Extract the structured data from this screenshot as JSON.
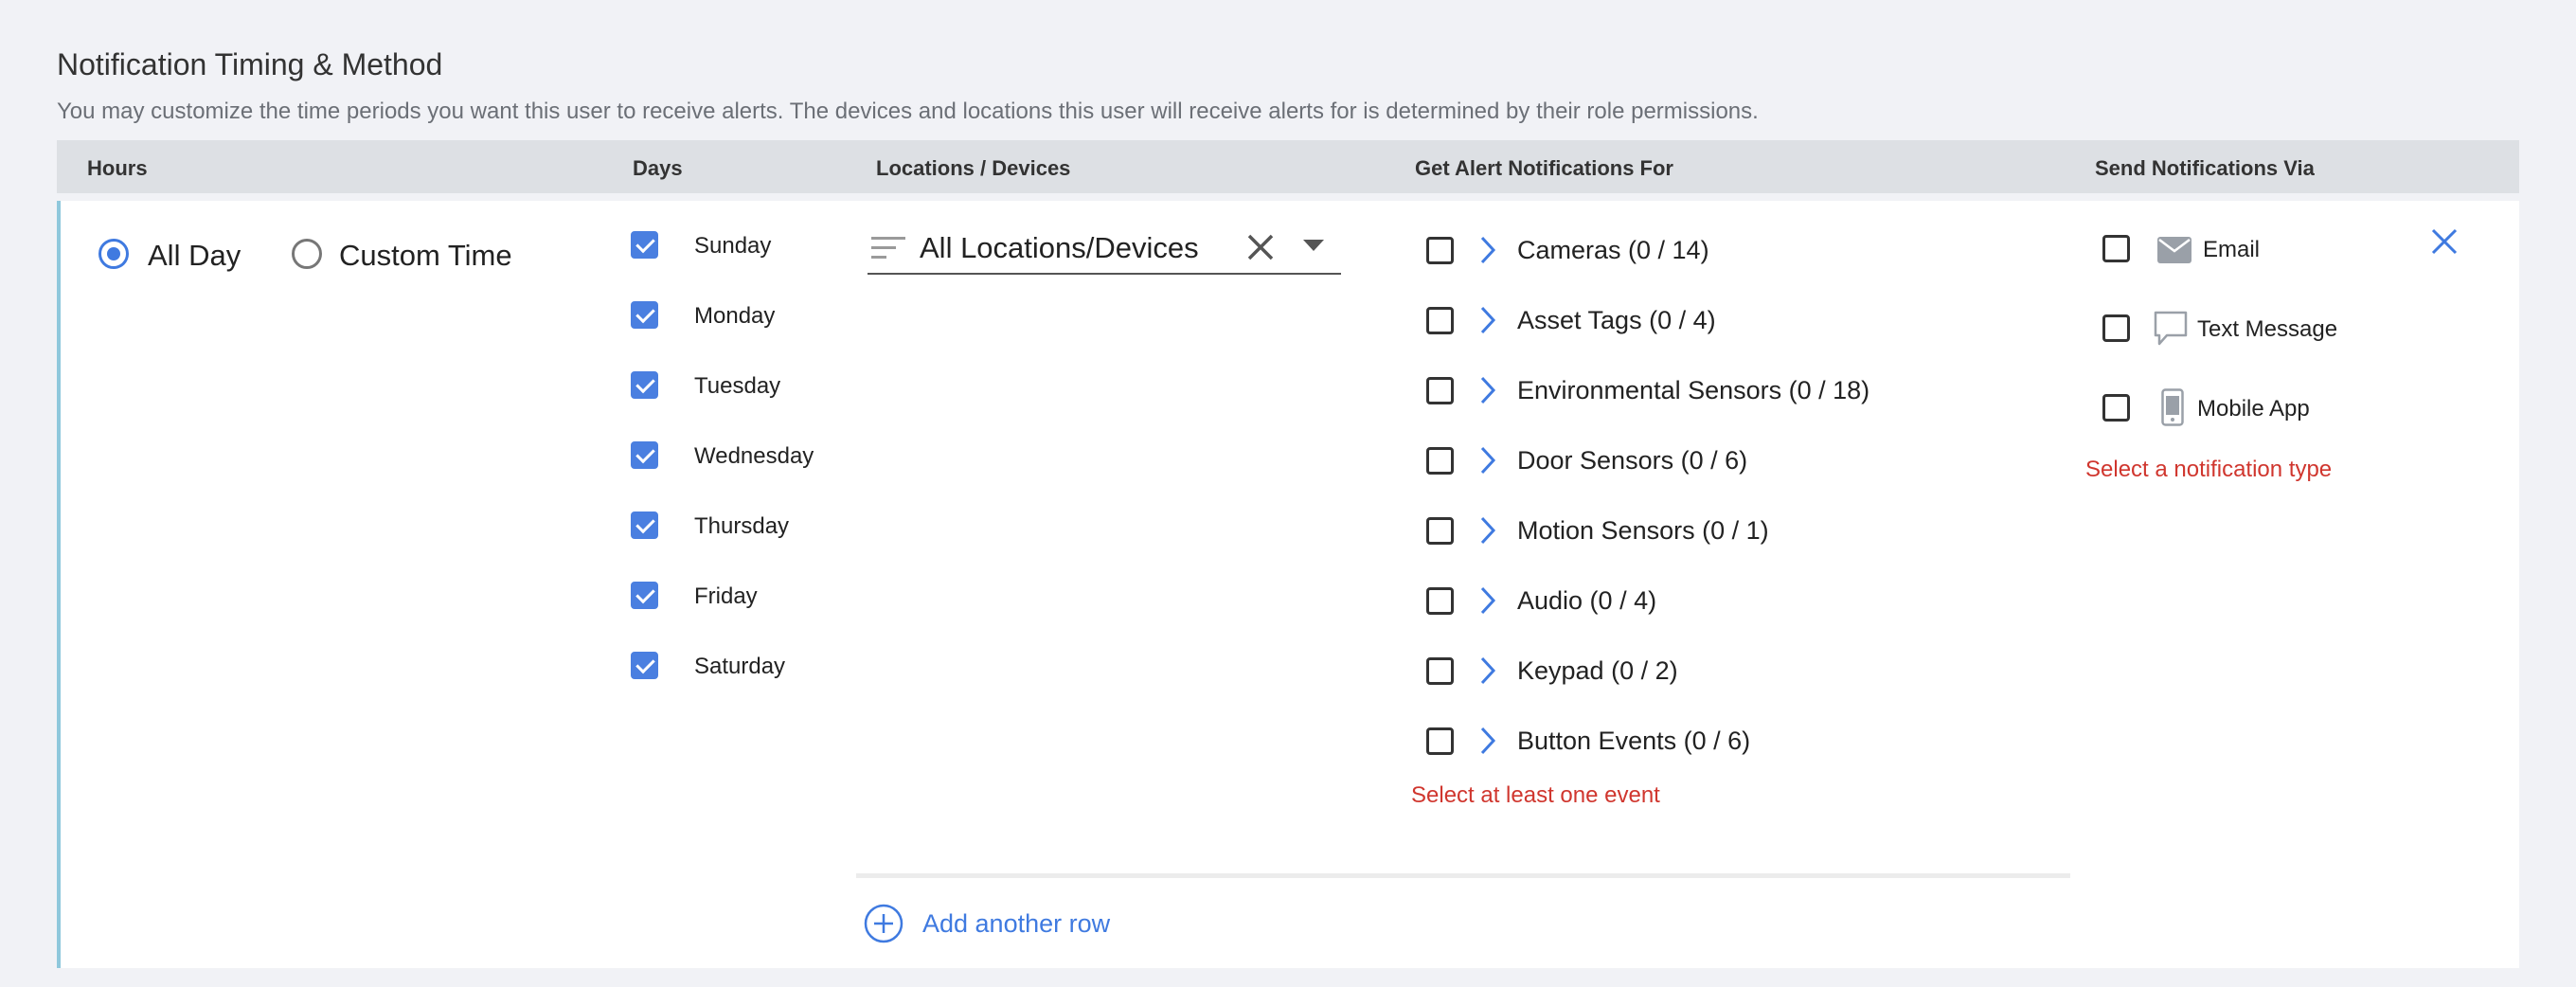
{
  "section": {
    "title": "Notification Timing & Method",
    "description": "You may customize the time periods you want this user to receive alerts. The devices and locations this user will receive alerts for is determined by their role permissions."
  },
  "columns": {
    "hours": "Hours",
    "days": "Days",
    "locations": "Locations / Devices",
    "alerts": "Get Alert Notifications For",
    "via": "Send Notifications Via"
  },
  "hours": {
    "all_day": "All Day",
    "custom_time": "Custom Time",
    "selected": "All Day"
  },
  "days": [
    {
      "label": "Sunday",
      "checked": true
    },
    {
      "label": "Monday",
      "checked": true
    },
    {
      "label": "Tuesday",
      "checked": true
    },
    {
      "label": "Wednesday",
      "checked": true
    },
    {
      "label": "Thursday",
      "checked": true
    },
    {
      "label": "Friday",
      "checked": true
    },
    {
      "label": "Saturday",
      "checked": true
    }
  ],
  "locations": {
    "value": "All Locations/Devices"
  },
  "events": [
    {
      "label": "Cameras (0 / 14)",
      "checked": false
    },
    {
      "label": "Asset Tags (0 / 4)",
      "checked": false
    },
    {
      "label": "Environmental Sensors (0 / 18)",
      "checked": false
    },
    {
      "label": "Door Sensors (0 / 6)",
      "checked": false
    },
    {
      "label": "Motion Sensors (0 / 1)",
      "checked": false
    },
    {
      "label": "Audio (0 / 4)",
      "checked": false
    },
    {
      "label": "Keypad (0 / 2)",
      "checked": false
    },
    {
      "label": "Button Events (0 / 6)",
      "checked": false
    }
  ],
  "events_error": "Select at least one event",
  "via": [
    {
      "label": "Email",
      "icon": "envelope-icon",
      "checked": false
    },
    {
      "label": "Text Message",
      "icon": "chat-bubble-icon",
      "checked": false
    },
    {
      "label": "Mobile App",
      "icon": "mobile-phone-icon",
      "checked": false
    }
  ],
  "via_error": "Select a notification type",
  "add_row": "Add another row",
  "colors": {
    "accent": "#3f7ae0",
    "checkbox": "#4a7fe0",
    "error": "#d0362e",
    "panel_border": "#8fc8dc",
    "header_bg": "#dde0e4"
  }
}
